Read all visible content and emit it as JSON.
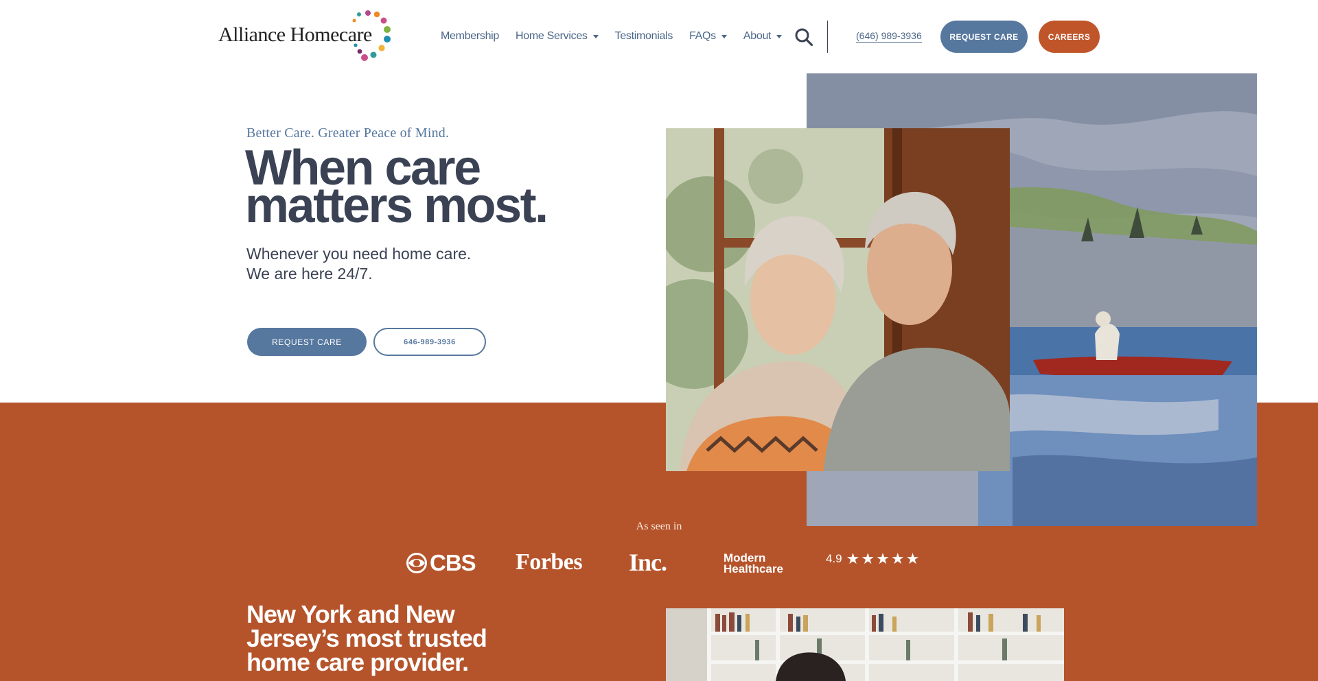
{
  "header": {
    "logo_text": "Alliance Homecare",
    "nav": [
      {
        "label": "Membership",
        "dropdown": false
      },
      {
        "label": "Home Services",
        "dropdown": true
      },
      {
        "label": "Testimonials",
        "dropdown": false
      },
      {
        "label": "FAQs",
        "dropdown": true
      },
      {
        "label": "About",
        "dropdown": true
      }
    ],
    "search_icon": "search-icon",
    "phone": "(646) 989-3936",
    "request_label": "REQUEST CARE",
    "careers_label": "CAREERS"
  },
  "hero": {
    "tagline": "Better Care. Greater Peace of Mind.",
    "title_line1": "When care",
    "title_line2": "matters most.",
    "sub_line1": "Whenever you need home care.",
    "sub_line2": "We are here 24/7.",
    "request_label": "REQUEST CARE",
    "phone_label": "646-989-3936"
  },
  "press": {
    "label": "As seen in",
    "logos": [
      "CBS",
      "Forbes",
      "Inc.",
      "Modern",
      "Healthcare"
    ],
    "rating": "4.9",
    "stars": 5
  },
  "trusted": {
    "line1": "New York and New",
    "line2": "Jersey’s most trusted",
    "line3": "home care provider."
  },
  "colors": {
    "navy_text": "#3a4254",
    "slate_blue": "#56779e",
    "burnt_orange": "#b5542b",
    "careers_orange": "#c0552a"
  }
}
